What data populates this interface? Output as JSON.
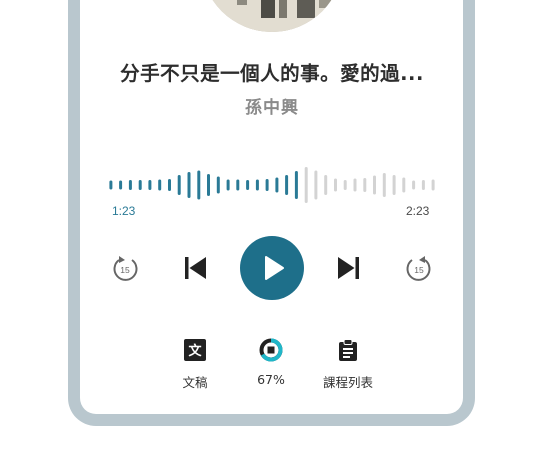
{
  "episode": {
    "title": "分手不只是一個人的事。愛的過...",
    "author": "孫中興"
  },
  "playback": {
    "current_time": "1:23",
    "total_time": "2:23",
    "progress": 0.58
  },
  "controls": {
    "rewind_seconds": "15",
    "forward_seconds": "15"
  },
  "tools": {
    "transcript_label": "文稿",
    "transcript_icon_glyph": "文",
    "completion_label": "67%",
    "completion_value": 0.67,
    "course_list_label": "課程列表"
  },
  "colors": {
    "accent": "#1e6f8a",
    "waveform_played": "#2a7a96",
    "waveform_unplayed": "#d3d3d3",
    "frame": "#b9c7ce"
  }
}
